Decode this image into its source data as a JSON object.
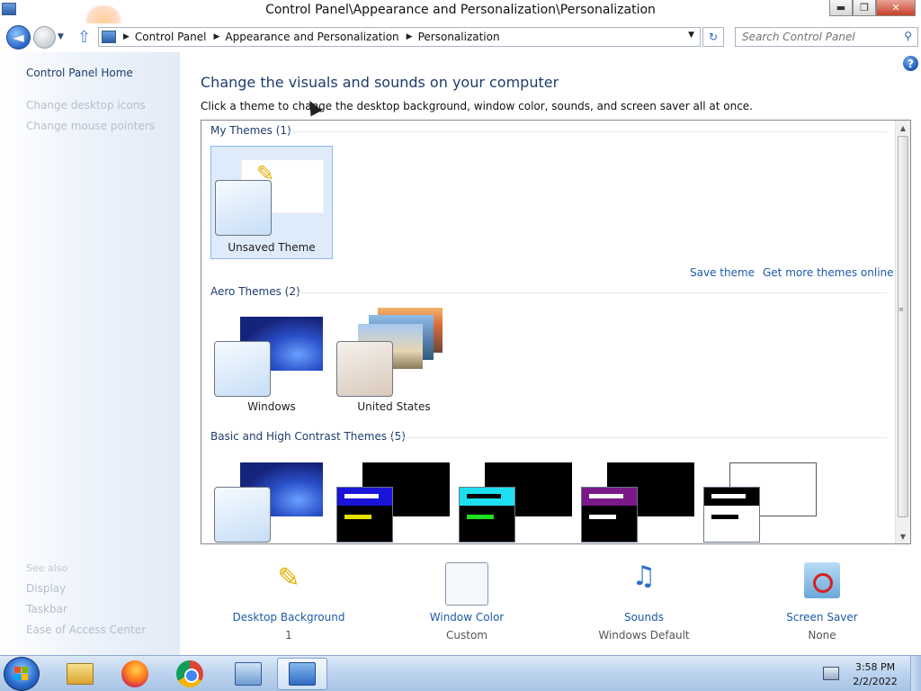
{
  "window": {
    "title": "Control Panel\\Appearance and Personalization\\Personalization",
    "min_glyph": "▬",
    "max_glyph": "❐",
    "close_glyph": "✕"
  },
  "nav": {
    "back_glyph": "◄",
    "history_glyph": "▼",
    "up_glyph": "⇧",
    "breadcrumbs": [
      "Control Panel",
      "Appearance and Personalization",
      "Personalization"
    ],
    "separator": "▶",
    "dropdown_glyph": "▼",
    "refresh_glyph": "↻",
    "search_placeholder": "Search Control Panel",
    "search_glyph": "⚲"
  },
  "leftpane": {
    "home": "Control Panel Home",
    "tasks": [
      "Change desktop icons",
      "Change mouse pointers"
    ],
    "see_also": "See also",
    "see_also_links": [
      "Display",
      "Taskbar",
      "Ease of Access Center"
    ]
  },
  "main": {
    "help_glyph": "?",
    "heading": "Change the visuals and sounds on your computer",
    "subheading": "Click a theme to change the desktop background, window color, sounds, and screen saver all at once.",
    "groups": {
      "my_themes": "My Themes (1)",
      "aero_themes": "Aero Themes (2)",
      "basic_themes": "Basic and High Contrast Themes (5)"
    },
    "my_themes": [
      {
        "label": "Unsaved Theme"
      }
    ],
    "aero_themes": [
      {
        "label": "Windows"
      },
      {
        "label": "United States"
      }
    ],
    "links": {
      "save_theme": "Save theme",
      "more_themes": "Get more themes online"
    },
    "scroll_up": "▲",
    "scroll_down": "▼",
    "scroll_grip": "≡"
  },
  "bottom": [
    {
      "link": "Desktop Background",
      "value": "1"
    },
    {
      "link": "Window Color",
      "value": "Custom"
    },
    {
      "link": "Sounds",
      "value": "Windows Default"
    },
    {
      "link": "Screen Saver",
      "value": "None"
    }
  ],
  "taskbar": {
    "time": "3:58 PM",
    "date": "2/2/2022"
  },
  "colors": {
    "link": "#1e5aa8",
    "heading": "#1e3c6c",
    "selected_bg": "#ddebfb"
  }
}
